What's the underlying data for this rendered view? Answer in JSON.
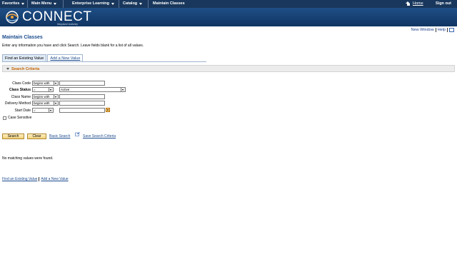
{
  "topnav": {
    "favorites": "Favorites",
    "main_menu": "Main Menu",
    "enterprise_learning": "Enterprise Learning",
    "catalog": "Catalog",
    "maintain_classes": "Maintain Classes",
    "home": "Home",
    "sign_out": "Sign out",
    "background": "#19375c"
  },
  "banner": {
    "logo_text": "CONNECT",
    "logo_sub": "Maryland Judiciary"
  },
  "utility": {
    "new_window": "New Window",
    "help": "Help"
  },
  "page": {
    "title": "Maintain Classes",
    "instructions": "Enter any information you have and click Search. Leave fields blank for a list of all values."
  },
  "tabs": [
    {
      "label": "Find an Existing Value",
      "active": true
    },
    {
      "label": "Add a New Value",
      "active": false
    }
  ],
  "criteria": {
    "header": "Search Criteria",
    "accent": "#c36400",
    "fields": [
      {
        "label": "Class Code",
        "operator": "begins with",
        "value": ""
      },
      {
        "label": "Class Status",
        "operator": "=",
        "value": "Active"
      },
      {
        "label": "Class Name",
        "operator": "begins with",
        "value": ""
      },
      {
        "label": "Delivery Method",
        "operator": "begins with",
        "value": ""
      },
      {
        "label": "Start Date",
        "operator": "=",
        "value": ""
      }
    ],
    "case_sensitive": "Case Sensitive"
  },
  "actions": {
    "search": "Search",
    "clear": "Clear",
    "basic_search": "Basic Search",
    "save_search": "Save Search Criteria"
  },
  "results": {
    "message": "No matching values were found."
  },
  "footer_links": {
    "find": "Find an Existing Value",
    "add": "Add a New Value"
  }
}
